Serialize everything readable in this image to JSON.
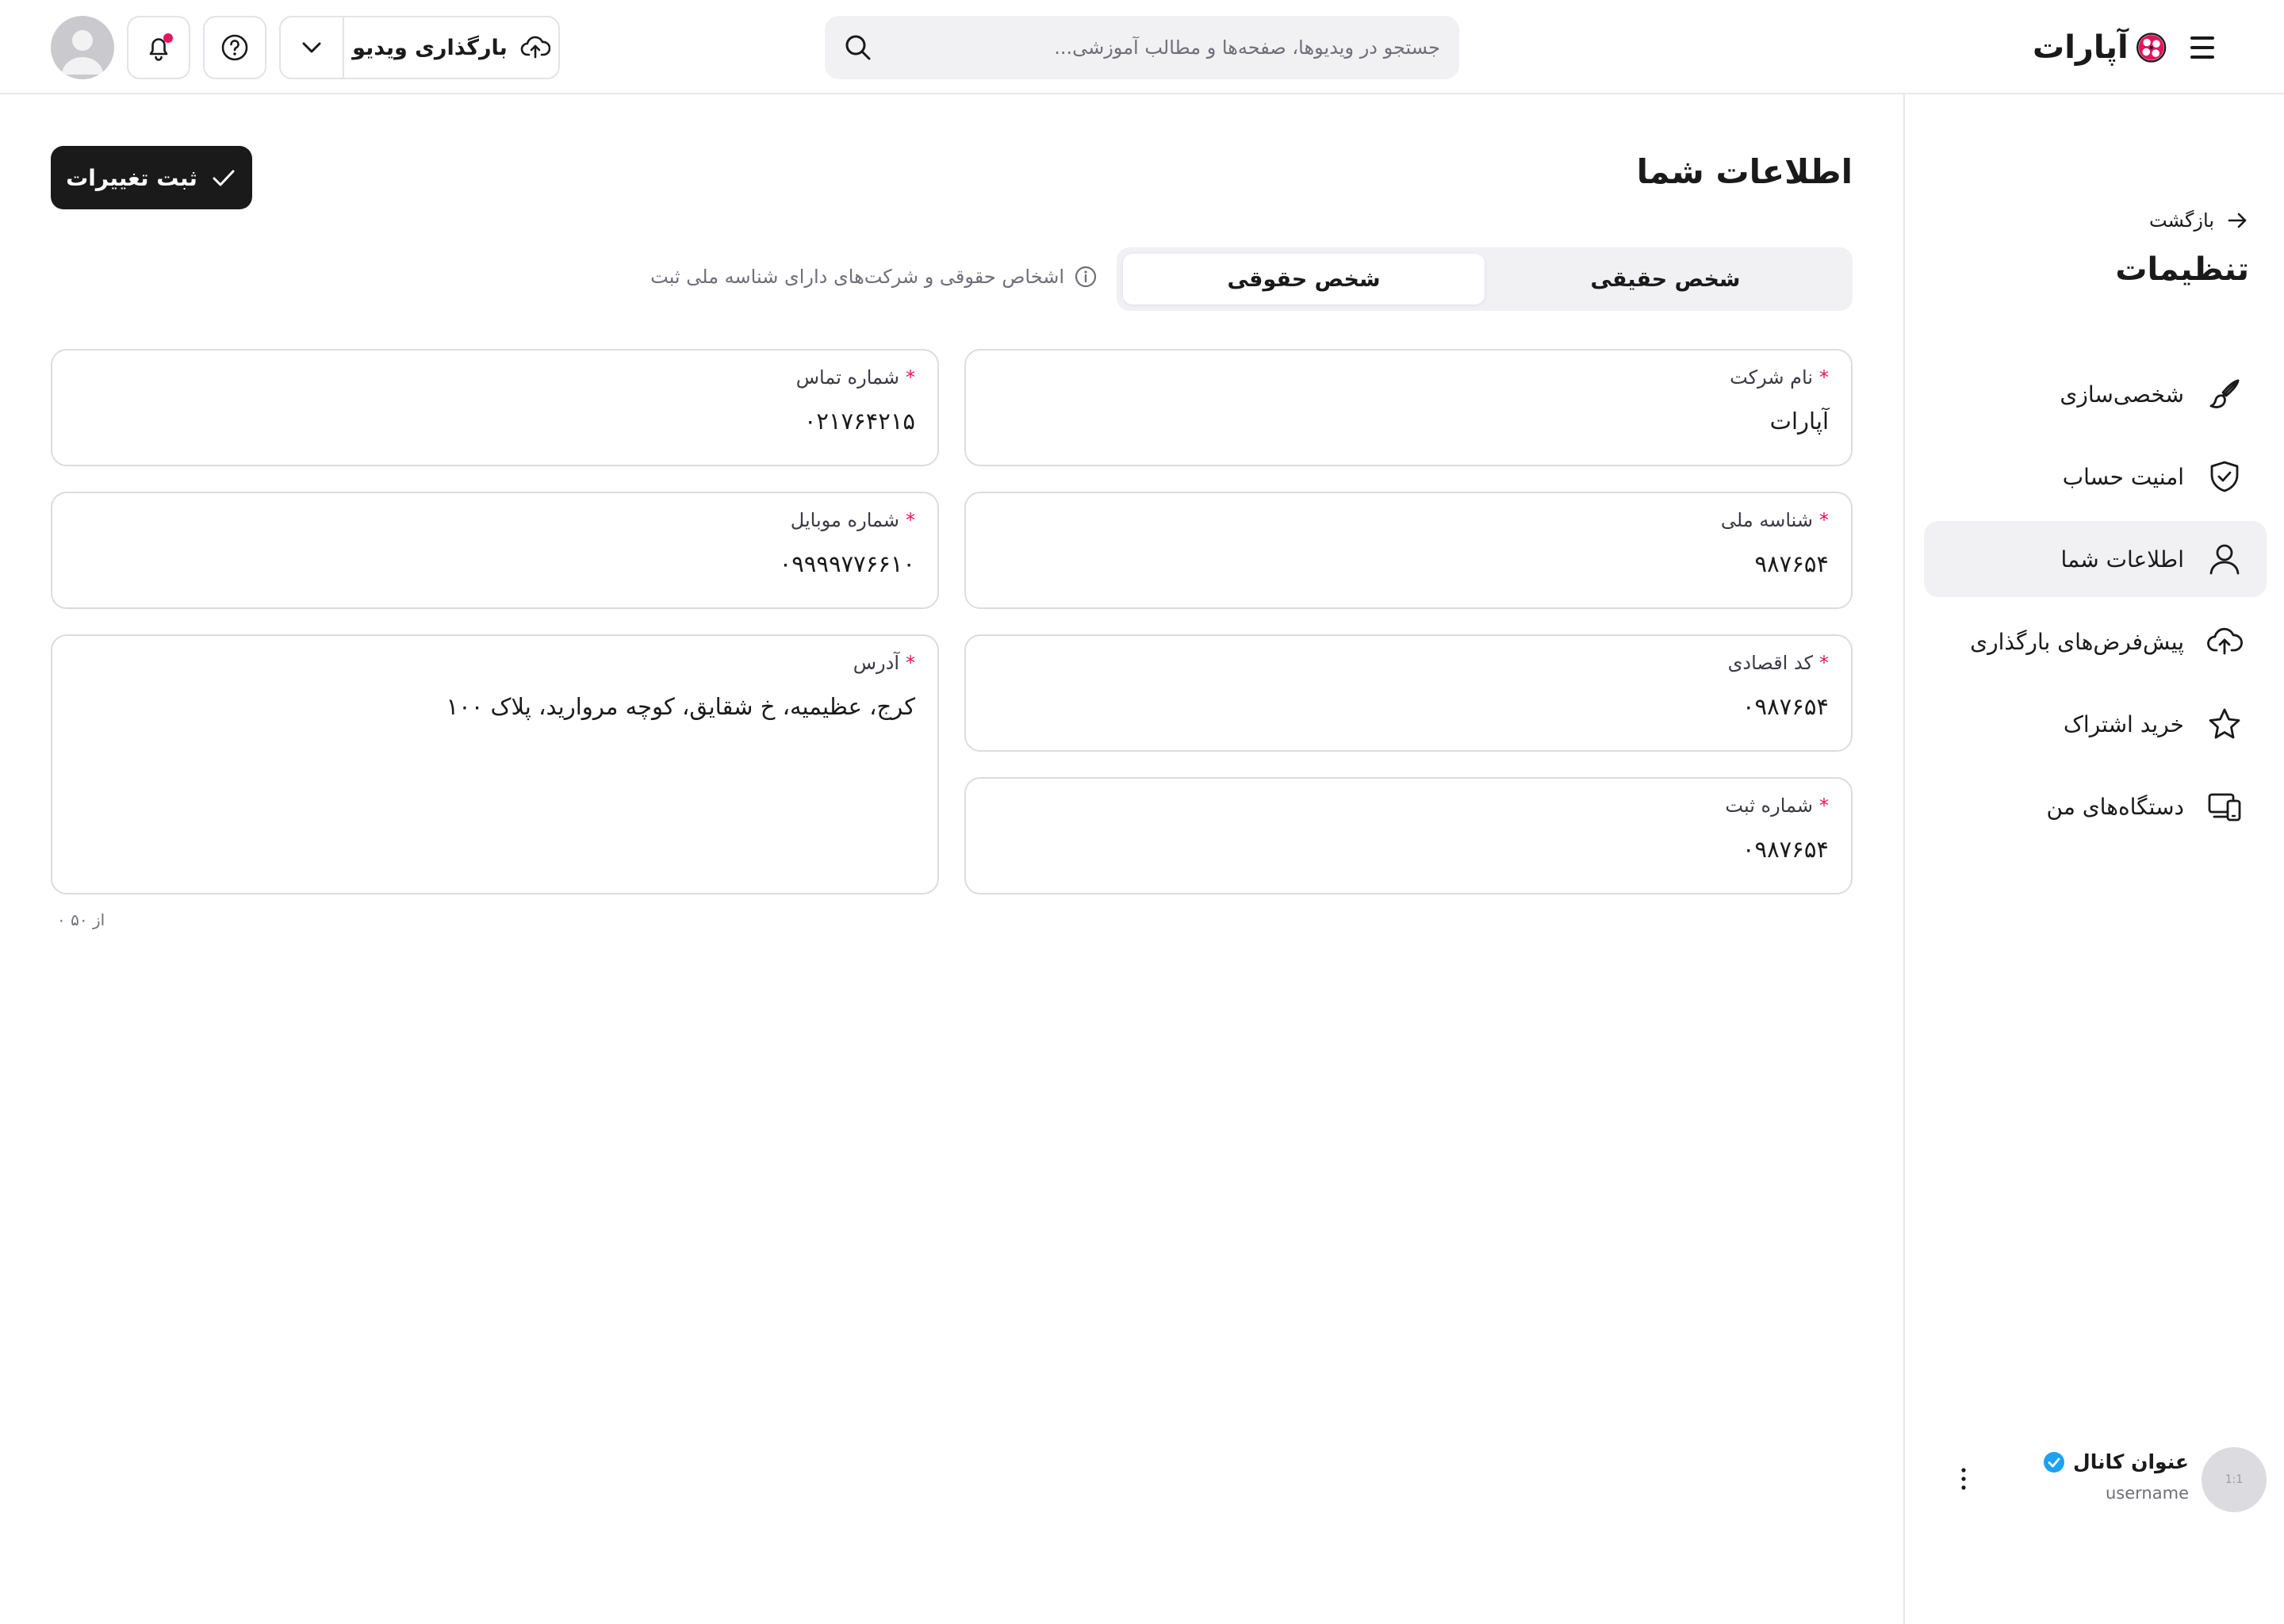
{
  "header": {
    "logo_text": "آپارات",
    "search_placeholder": "جستجو در ویدیوها، صفحه‌ها و مطالب آموزشی...",
    "upload_label": "بارگذاری ویدیو"
  },
  "sidebar": {
    "back_label": "بازگشت",
    "title": "تنظیمات",
    "items": [
      {
        "label": "شخصی‌سازی",
        "icon": "brush-icon"
      },
      {
        "label": "امنیت حساب",
        "icon": "shield-check-icon"
      },
      {
        "label": "اطلاعات شما",
        "icon": "user-icon",
        "active": true
      },
      {
        "label": "پیش‌فرض‌های بارگذاری",
        "icon": "cloud-upload-icon"
      },
      {
        "label": "خرید اشتراک",
        "icon": "star-icon"
      },
      {
        "label": "دستگاه‌های من",
        "icon": "devices-icon"
      }
    ],
    "channel": {
      "name": "عنوان کانال",
      "username": "username",
      "avatar_text": "1:1"
    }
  },
  "main": {
    "title": "اطلاعات شما",
    "save_label": "ثبت تغییرات",
    "tabs": [
      {
        "label": "شخص حقیقی",
        "active": false
      },
      {
        "label": "شخص حقوقی",
        "active": true
      }
    ],
    "hint": "اشخاص حقوقی و شرکت‌های دارای شناسه ملی ثبت",
    "fields": {
      "company_name": {
        "label": "نام شرکت",
        "value": "آپارات"
      },
      "national_id": {
        "label": "شناسه ملی",
        "value": "۹۸۷۶۵۴"
      },
      "economic_code": {
        "label": "کد اقصادی",
        "value": "۰۹۸۷۶۵۴"
      },
      "registration_number": {
        "label": "شماره ثبت",
        "value": "۰۹۸۷۶۵۴"
      },
      "contact_number": {
        "label": "شماره تماس",
        "value": "۰۲۱۷۶۴۲۱۵"
      },
      "mobile_number": {
        "label": "شماره موبایل",
        "value": "۰۹۹۹۹۷۷۶۶۱۰"
      },
      "address": {
        "label": "آدرس",
        "value": "کرج، عظیمیه، خ شقایق، کوچه مروارید، پلاک ۱۰۰"
      }
    },
    "required_mark": "*",
    "address_counter": "۰ از ۵۰"
  },
  "colors": {
    "accent": "#e4145f",
    "dark_button": "#1a1a1a",
    "verified": "#1da1f2"
  }
}
